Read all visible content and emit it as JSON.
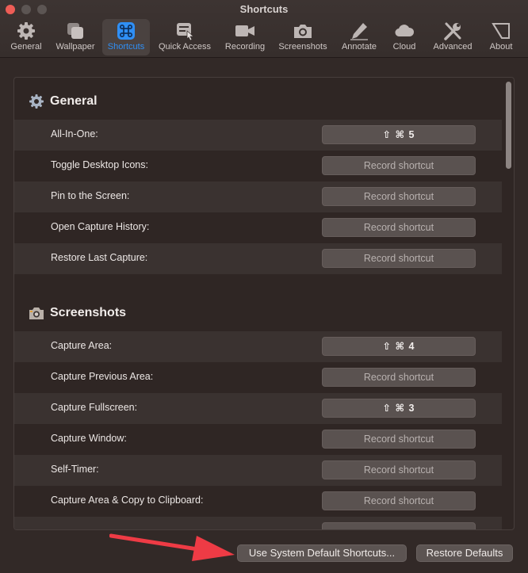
{
  "window": {
    "title": "Shortcuts"
  },
  "toolbar": {
    "items": [
      {
        "label": "General",
        "icon": "gear-icon"
      },
      {
        "label": "Wallpaper",
        "icon": "wallpaper-icon"
      },
      {
        "label": "Shortcuts",
        "icon": "command-key-icon",
        "active": true
      },
      {
        "label": "Quick Access",
        "icon": "quick-access-icon"
      },
      {
        "label": "Recording",
        "icon": "video-camera-icon"
      },
      {
        "label": "Screenshots",
        "icon": "camera-icon"
      },
      {
        "label": "Annotate",
        "icon": "pencil-icon"
      },
      {
        "label": "Cloud",
        "icon": "cloud-icon"
      },
      {
        "label": "Advanced",
        "icon": "tools-icon"
      },
      {
        "label": "About",
        "icon": "about-icon"
      }
    ]
  },
  "sections": [
    {
      "title": "General",
      "icon": "gear-icon",
      "rows": [
        {
          "label": "All-In-One:",
          "shortcut": "⇧ ⌘ 5"
        },
        {
          "label": "Toggle Desktop Icons:",
          "shortcut": "Record shortcut"
        },
        {
          "label": "Pin to the Screen:",
          "shortcut": "Record shortcut"
        },
        {
          "label": "Open Capture History:",
          "shortcut": "Record shortcut"
        },
        {
          "label": "Restore Last Capture:",
          "shortcut": "Record shortcut"
        }
      ]
    },
    {
      "title": "Screenshots",
      "icon": "camera-icon",
      "rows": [
        {
          "label": "Capture Area:",
          "shortcut": "⇧ ⌘ 4"
        },
        {
          "label": "Capture Previous Area:",
          "shortcut": "Record shortcut"
        },
        {
          "label": "Capture Fullscreen:",
          "shortcut": "⇧ ⌘ 3"
        },
        {
          "label": "Capture Window:",
          "shortcut": "Record shortcut"
        },
        {
          "label": "Self-Timer:",
          "shortcut": "Record shortcut"
        },
        {
          "label": "Capture Area & Copy to Clipboard:",
          "shortcut": "Record shortcut"
        }
      ]
    }
  ],
  "footer": {
    "system_defaults_label": "Use System Default Shortcuts...",
    "restore_defaults_label": "Restore Defaults"
  },
  "colors": {
    "accent": "#2f8ff5",
    "annotation_arrow": "#ee3b45"
  }
}
